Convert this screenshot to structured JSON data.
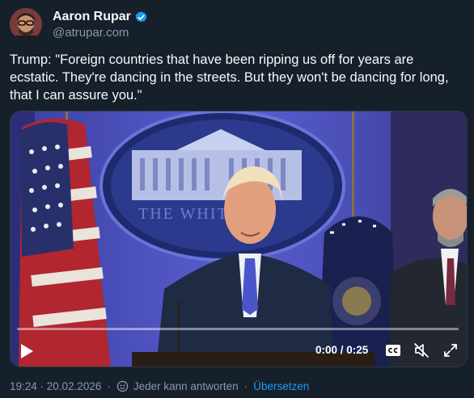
{
  "author": {
    "name": "Aaron Rupar",
    "handle": "@atrupar.com",
    "verified": true
  },
  "tweet": {
    "text": "Trump: \"Foreign countries that have been ripping us off for years are ecstatic. They're dancing in the streets. But they won't be dancing for long, that I can assure you.\""
  },
  "video": {
    "time_display": "0:00 / 0:25",
    "podium_seal_text": "THE WHITE",
    "progress_fraction": 0,
    "controls": [
      "play-icon",
      "closed-captions-icon",
      "mute-icon",
      "fullscreen-icon"
    ]
  },
  "footer": {
    "timestamp": "19:24 · 20.02.2026",
    "reply_setting": "Jeder kann antworten",
    "separator": "·",
    "translate_label": "Übersetzen"
  },
  "colors": {
    "background": "#15202b",
    "text": "#f7f9f9",
    "secondary": "#8b98a5",
    "accent": "#1d9bf0"
  }
}
